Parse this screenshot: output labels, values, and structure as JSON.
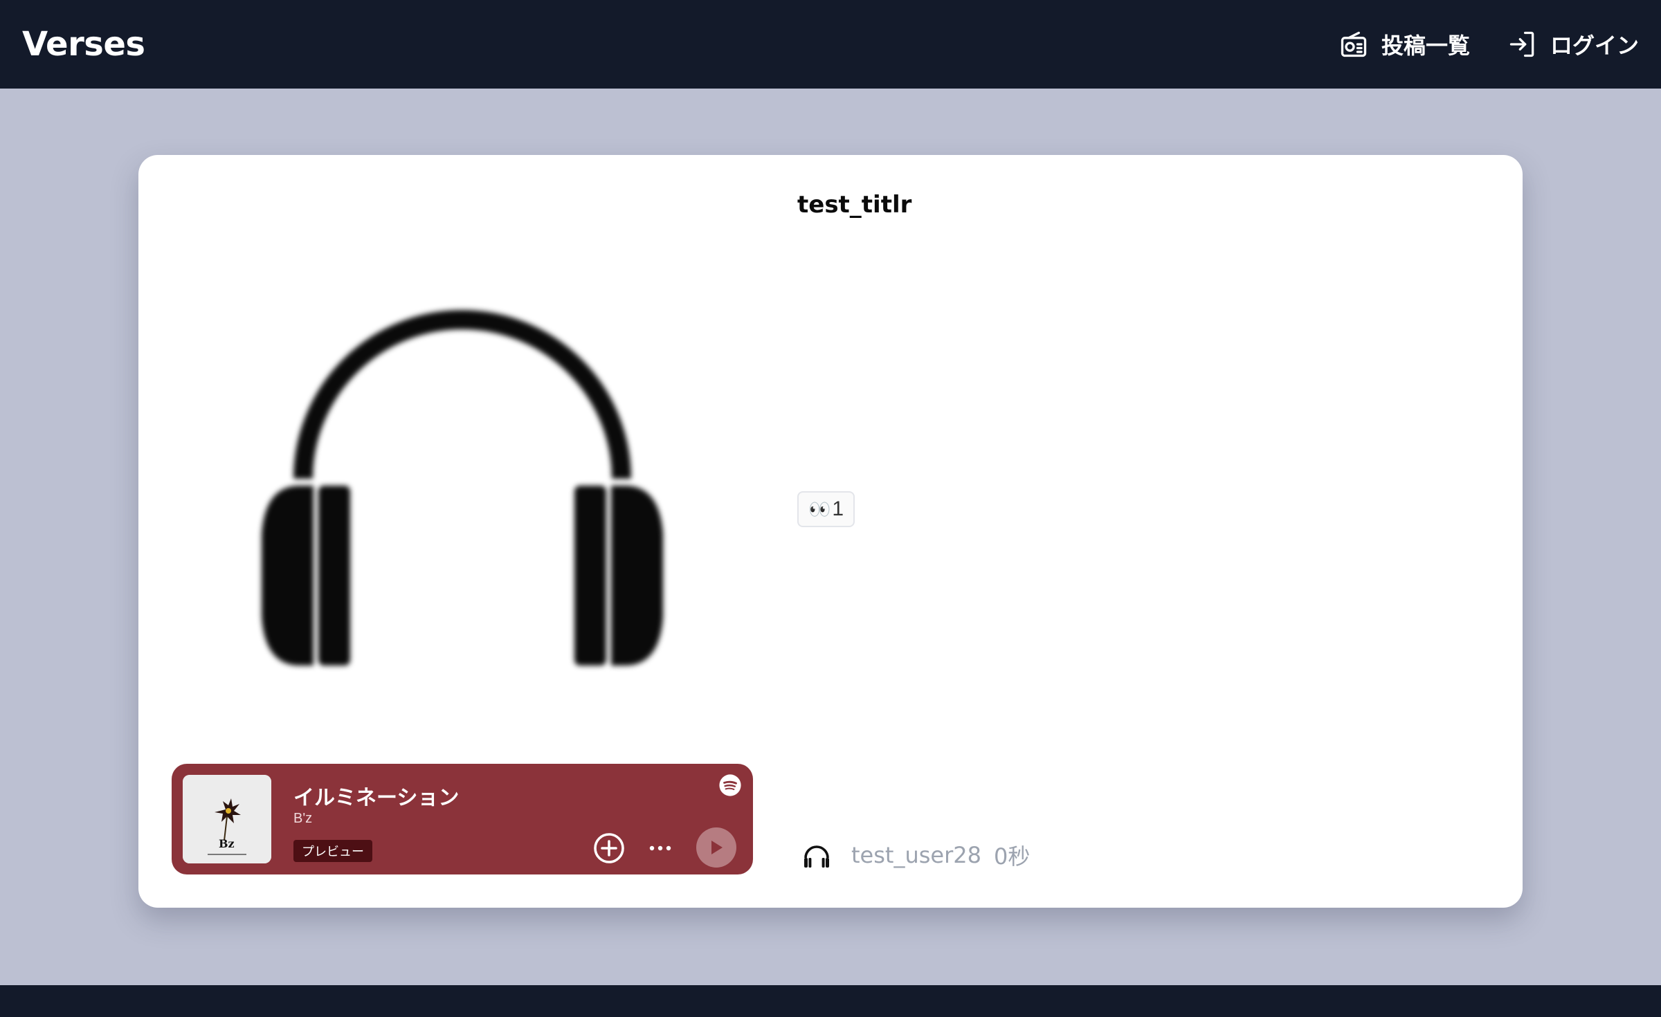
{
  "navbar": {
    "brand": "Verses",
    "links": [
      {
        "label": "投稿一覧",
        "icon": "radio-icon"
      },
      {
        "label": "ログイン",
        "icon": "login-icon"
      }
    ]
  },
  "post": {
    "title": "test_titlr",
    "artwork_icon": "headphones-icon",
    "reaction": {
      "emoji": "👀",
      "count": "1"
    },
    "author": {
      "icon": "headphones-icon",
      "name": "test_user28",
      "time_ago": "0秒"
    }
  },
  "player": {
    "track_title": "イルミネーション",
    "artist": "B'z",
    "badge": "プレビュー",
    "background_color": "#8b333a",
    "icons": [
      "spotify-icon",
      "add-circle-icon",
      "more-icon",
      "play-icon"
    ]
  },
  "colors": {
    "navbar": "#131a2a",
    "page_background": "#bcc0d2",
    "card": "#ffffff",
    "muted_text": "#9ca3af"
  }
}
